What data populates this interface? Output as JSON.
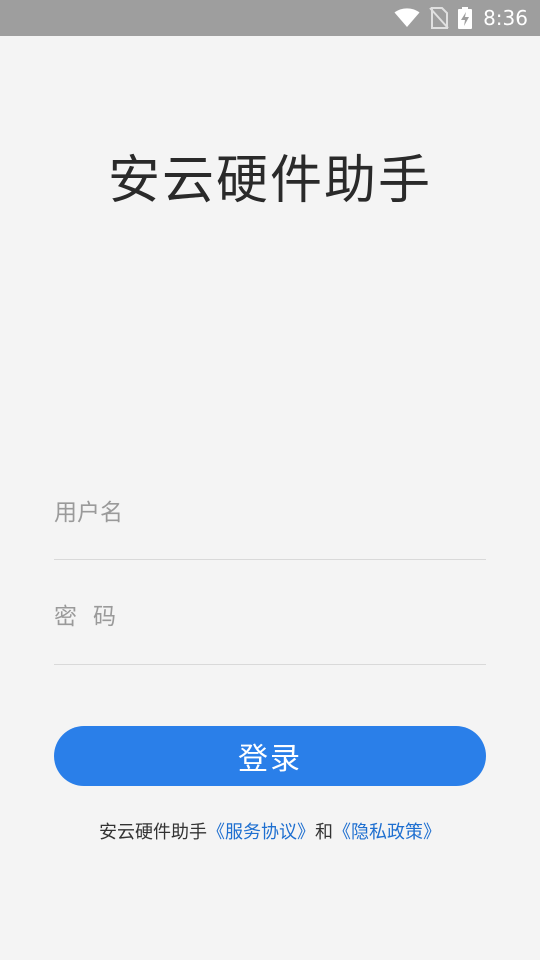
{
  "status_bar": {
    "time": "8:36",
    "icons": [
      "wifi-icon",
      "no-sim-icon",
      "battery-charging-icon"
    ]
  },
  "app": {
    "title": "安云硬件助手"
  },
  "form": {
    "username_placeholder": "用户名",
    "username_value": "",
    "password_placeholder": "密码",
    "password_value": "",
    "login_label": "登录"
  },
  "agreement": {
    "prefix": "安云硬件助手",
    "service_link": "《服务协议》",
    "connector": "和",
    "privacy_link": "《隐私政策》"
  },
  "colors": {
    "background": "#f4f4f4",
    "status_bar": "#9e9e9e",
    "primary": "#2a7fe9",
    "link": "#1e6fd0"
  }
}
